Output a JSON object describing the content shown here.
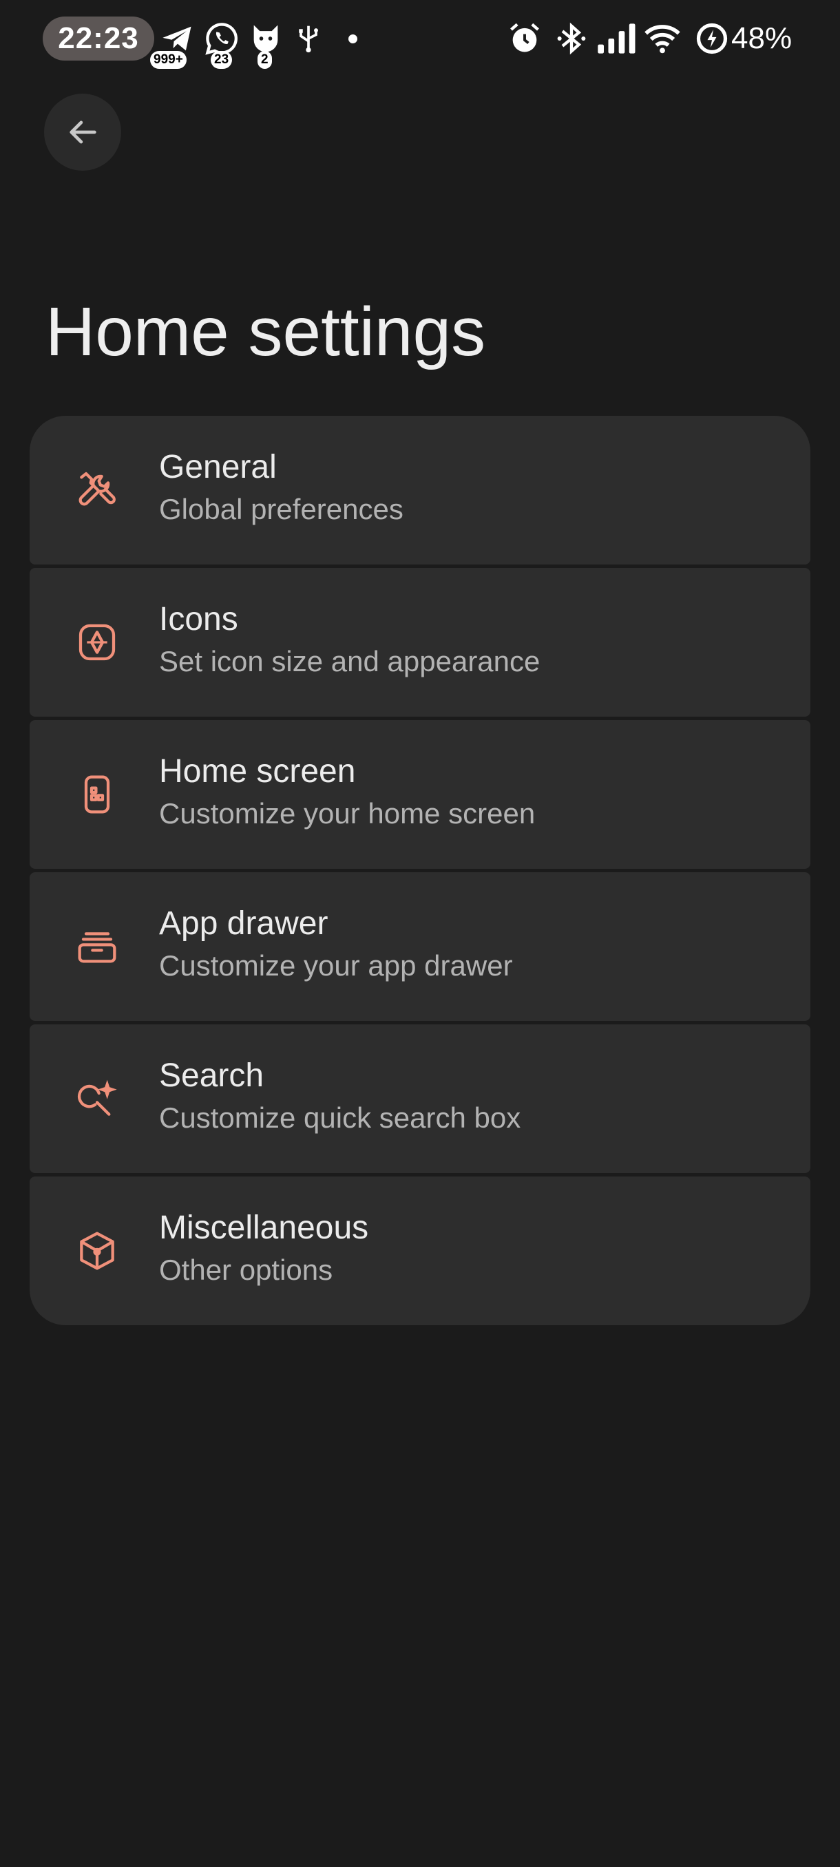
{
  "status_bar": {
    "time": "22:23",
    "telegram_badge": "999+",
    "whatsapp_badge": "23",
    "cat_app_badge": "2",
    "battery_percent": "48%",
    "icons": [
      "telegram-icon",
      "whatsapp-icon",
      "cat-app-icon",
      "usb-icon",
      "alarm-icon",
      "bluetooth-icon",
      "signal-icon",
      "wifi-icon",
      "battery-saver-icon"
    ]
  },
  "header": {
    "back_icon": "arrow-left-icon",
    "title": "Home settings"
  },
  "colors": {
    "background": "#1b1b1b",
    "card": "#2d2d2d",
    "accent": "#f0907a",
    "text_primary": "#ececec",
    "text_secondary": "#b3b3b3"
  },
  "settings": {
    "items": [
      {
        "title": "General",
        "subtitle": "Global preferences",
        "icon": "tools-icon"
      },
      {
        "title": "Icons",
        "subtitle": "Set icon size and appearance",
        "icon": "icon-shape-icon"
      },
      {
        "title": "Home screen",
        "subtitle": "Customize your home screen",
        "icon": "phone-icon"
      },
      {
        "title": "App drawer",
        "subtitle": "Customize your app drawer",
        "icon": "drawer-icon"
      },
      {
        "title": "Search",
        "subtitle": "Customize quick search box",
        "icon": "search-sparkle-icon"
      },
      {
        "title": "Miscellaneous",
        "subtitle": "Other options",
        "icon": "cube-icon"
      }
    ]
  }
}
